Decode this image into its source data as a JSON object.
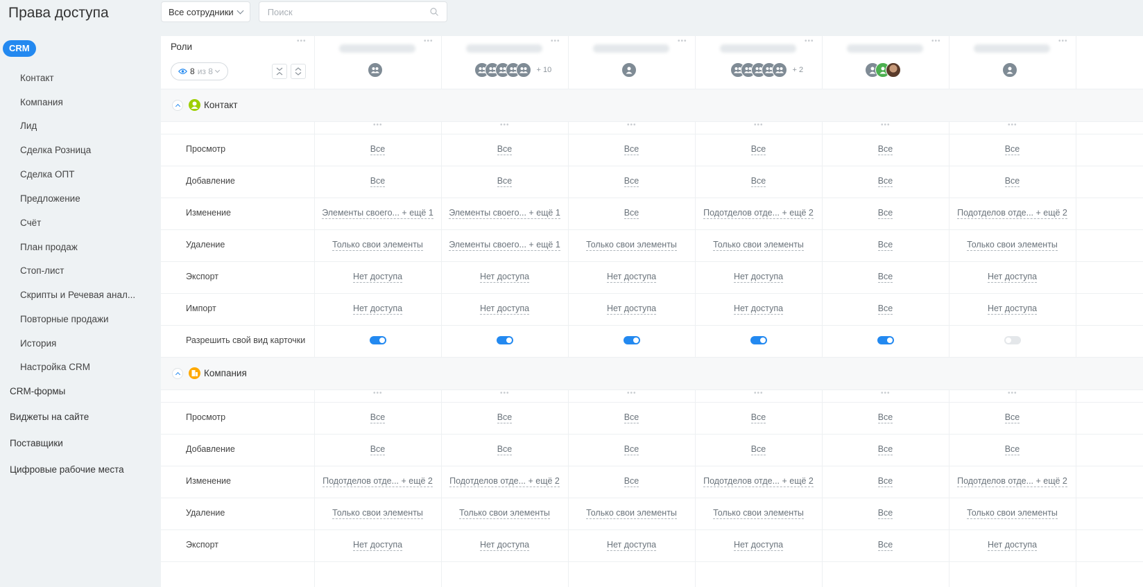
{
  "page": {
    "title": "Права доступа"
  },
  "toolbar": {
    "filter_label": "Все сотрудники",
    "search_placeholder": "Поиск"
  },
  "sidebar": {
    "active": "CRM",
    "sub_items": [
      "Контакт",
      "Компания",
      "Лид",
      "Сделка Розница",
      "Сделка ОПТ",
      "Предложение",
      "Счёт",
      "План продаж",
      "Стоп-лист",
      "Скрипты и Речевая анал...",
      "Повторные продажи",
      "История",
      "Настройка CRM"
    ],
    "top_items": [
      "CRM-формы",
      "Виджеты на сайте",
      "Поставщики",
      "Цифровые рабочие места"
    ]
  },
  "header": {
    "roles_label": "Роли",
    "visible_count": "8",
    "visible_of": "из 8",
    "columns": [
      {
        "avatars": [
          "group"
        ],
        "more": ""
      },
      {
        "avatars": [
          "group",
          "group",
          "group",
          "group",
          "group"
        ],
        "more": "+ 10"
      },
      {
        "avatars": [
          "user"
        ],
        "more": ""
      },
      {
        "avatars": [
          "group",
          "group",
          "group",
          "group",
          "group"
        ],
        "more": "+ 2"
      },
      {
        "avatars": [
          "user",
          "green",
          "photo"
        ],
        "more": ""
      },
      {
        "avatars": [
          "user"
        ],
        "more": ""
      }
    ]
  },
  "sections": [
    {
      "title": "Контакт",
      "icon_color": "#9dcf00",
      "rows": [
        {
          "label": "Просмотр",
          "cells": [
            "Все",
            "Все",
            "Все",
            "Все",
            "Все",
            "Все"
          ]
        },
        {
          "label": "Добавление",
          "cells": [
            "Все",
            "Все",
            "Все",
            "Все",
            "Все",
            "Все"
          ]
        },
        {
          "label": "Изменение",
          "cells": [
            "Элементы своего... + ещё 1",
            "Элементы своего... + ещё 1",
            "Все",
            "Подотделов отде... + ещё 2",
            "Все",
            "Подотделов отде... + ещё 2"
          ]
        },
        {
          "label": "Удаление",
          "cells": [
            "Только свои элементы",
            "Элементы своего... + ещё 1",
            "Только свои элементы",
            "Только свои элементы",
            "Все",
            "Только свои элементы"
          ]
        },
        {
          "label": "Экспорт",
          "cells": [
            "Нет доступа",
            "Нет доступа",
            "Нет доступа",
            "Нет доступа",
            "Все",
            "Нет доступа"
          ]
        },
        {
          "label": "Импорт",
          "cells": [
            "Нет доступа",
            "Нет доступа",
            "Нет доступа",
            "Нет доступа",
            "Все",
            "Нет доступа"
          ]
        },
        {
          "label": "Разрешить свой вид карточки",
          "toggles": [
            true,
            true,
            true,
            true,
            true,
            false
          ]
        }
      ]
    },
    {
      "title": "Компания",
      "icon_color": "#ffa900",
      "rows": [
        {
          "label": "Просмотр",
          "cells": [
            "Все",
            "Все",
            "Все",
            "Все",
            "Все",
            "Все"
          ]
        },
        {
          "label": "Добавление",
          "cells": [
            "Все",
            "Все",
            "Все",
            "Все",
            "Все",
            "Все"
          ]
        },
        {
          "label": "Изменение",
          "cells": [
            "Подотделов отде... + ещё 2",
            "Подотделов отде... + ещё 2",
            "Все",
            "Подотделов отде... + ещё 2",
            "Все",
            "Подотделов отде... + ещё 2"
          ]
        },
        {
          "label": "Удаление",
          "cells": [
            "Только свои элементы",
            "Только свои элементы",
            "Только свои элементы",
            "Только свои элементы",
            "Все",
            "Только свои элементы"
          ]
        },
        {
          "label": "Экспорт",
          "cells": [
            "Нет доступа",
            "Нет доступа",
            "Нет доступа",
            "Нет доступа",
            "Все",
            "Нет доступа"
          ]
        }
      ]
    }
  ],
  "colors": {
    "accent": "#2389f0",
    "background": "#eef2f4"
  }
}
